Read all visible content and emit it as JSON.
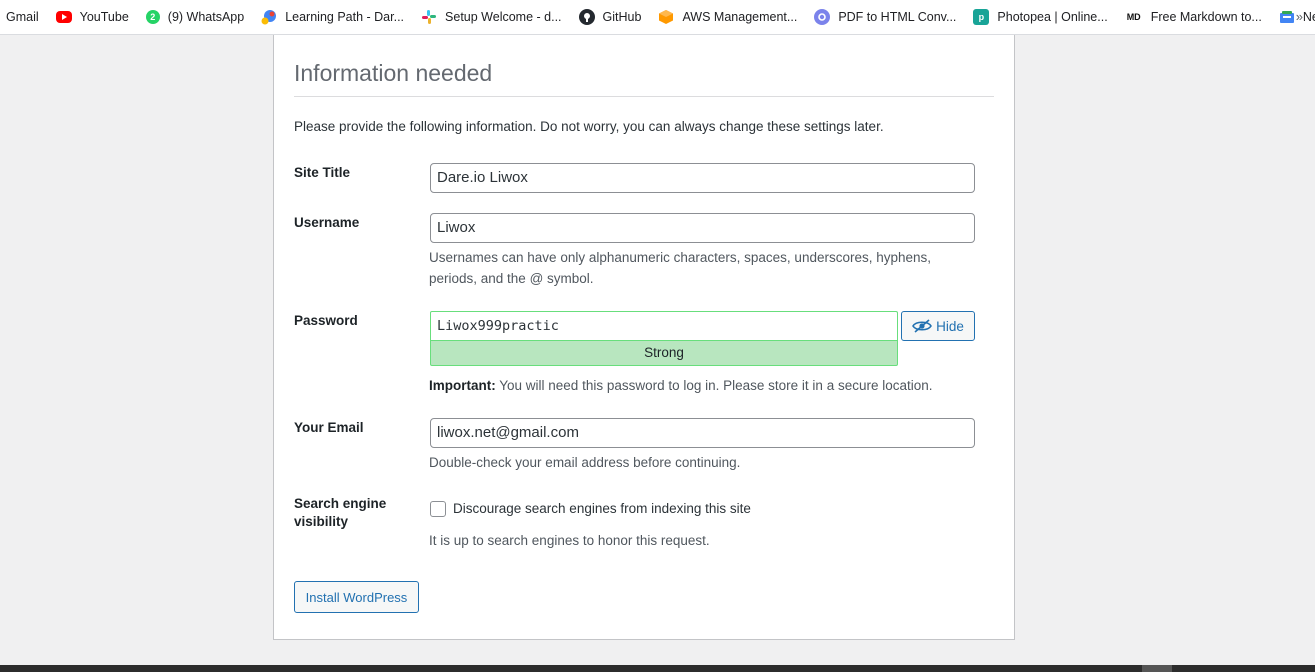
{
  "bookmarks": [
    {
      "label": "Gmail",
      "icon": "none",
      "color": ""
    },
    {
      "label": "YouTube",
      "icon": "youtube-icon",
      "color": "#ff0000"
    },
    {
      "label": "(9) WhatsApp",
      "icon": "whatsapp-icon",
      "color": "#25d366"
    },
    {
      "label": "Learning Path - Dar...",
      "icon": "learning-path-icon",
      "color": "#4285f4"
    },
    {
      "label": "Setup Welcome - d...",
      "icon": "slack-icon",
      "color": "#e01e5a"
    },
    {
      "label": "GitHub",
      "icon": "github-icon",
      "color": "#24292f"
    },
    {
      "label": "AWS Management...",
      "icon": "aws-icon",
      "color": "#ff9900"
    },
    {
      "label": "PDF to HTML Conv...",
      "icon": "pdf-icon",
      "color": "#7b83eb"
    },
    {
      "label": "Photopea | Online...",
      "icon": "photopea-icon",
      "color": "#18a497"
    },
    {
      "label": "Free Markdown to...",
      "icon": "markdown-icon",
      "color": "#111111"
    },
    {
      "label": "News",
      "icon": "news-icon",
      "color": "#4285f4"
    }
  ],
  "bookmarks_more": "»",
  "form": {
    "heading": "Information needed",
    "intro": "Please provide the following information. Do not worry, you can always change these settings later.",
    "site_title": {
      "label": "Site Title",
      "value": "Dare.io Liwox"
    },
    "username": {
      "label": "Username",
      "value": "Liwox",
      "hint_line1": "Usernames can have only alphanumeric characters, spaces, underscores, hyphens,",
      "hint_line2": "periods, and the @ symbol."
    },
    "password": {
      "label": "Password",
      "value": "Liwox999practic",
      "strength": "Strong",
      "hide_label": "Hide",
      "important_label": "Important:",
      "important_text": " You will need this password to log in. Please store it in a secure location."
    },
    "email": {
      "label": "Your Email",
      "value": "liwox.net@gmail.com",
      "hint": "Double-check your email address before continuing."
    },
    "search_visibility": {
      "label_line1": "Search engine",
      "label_line2": "visibility",
      "checkbox_label": "Discourage search engines from indexing this site",
      "checked": false,
      "hint": "It is up to search engines to honor this request."
    },
    "submit_label": "Install WordPress"
  }
}
